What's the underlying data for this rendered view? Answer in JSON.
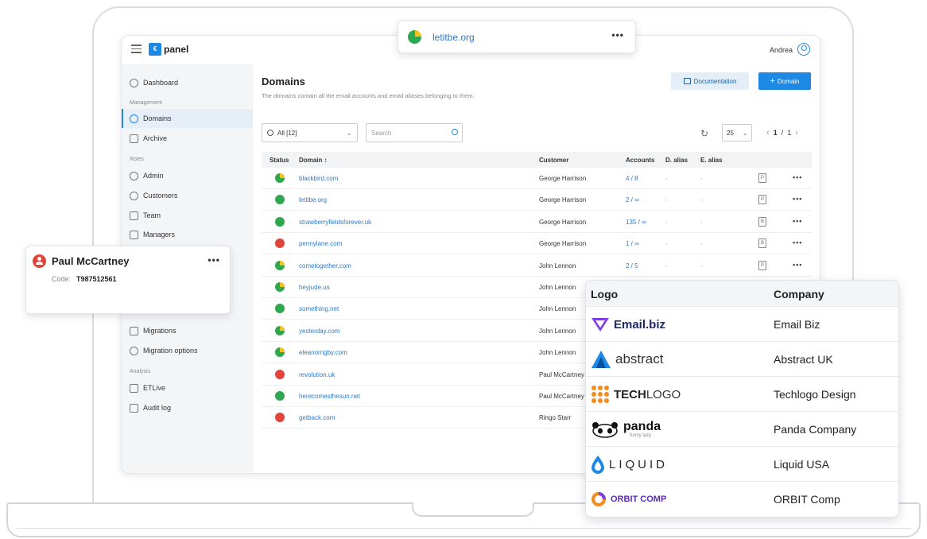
{
  "app": {
    "logo_text": "panel",
    "user_name": "Andrea"
  },
  "sidebar": {
    "dashboard": "Dashboard",
    "section_management": "Management",
    "domains": "Domains",
    "archive": "Archive",
    "section_roles": "Roles",
    "admin": "Admin",
    "customers": "Customers",
    "team": "Team",
    "managers": "Managers",
    "migrations": "Migrations",
    "migration_options": "Migration options",
    "section_analysis": "Analysis",
    "etlive": "ETLive",
    "audit_log": "Audit log"
  },
  "page": {
    "title": "Domains",
    "description": "The domains contain all the email accounts and email aliases belonging to them.",
    "documentation_label": "Documentation",
    "add_domain_label": "Domain",
    "add_domain_icon": "+"
  },
  "toolbar": {
    "filter_value": "All [12]",
    "search_placeholder": "Search",
    "per_page": "25",
    "pager_current": "1",
    "pager_total": "1"
  },
  "table": {
    "headers": [
      "Status",
      "Domain ↕",
      "Customer",
      "Accounts",
      "D. alias",
      "E. alias"
    ],
    "rows": [
      {
        "status": "mixed",
        "domain": "blackbird.com",
        "customer": "George Harrison",
        "accounts": "4 / 8",
        "dalias": "-",
        "ealias": "-",
        "doc": "P"
      },
      {
        "status": "green",
        "domain": "letitbe.org",
        "customer": "George Harrison",
        "accounts": "2 / ∞",
        "dalias": "-",
        "ealias": "-",
        "doc": "P"
      },
      {
        "status": "green",
        "domain": "strawberryfieldsforever.uk",
        "customer": "George Harrison",
        "accounts": "135 / ∞",
        "dalias": "-",
        "ealias": "-",
        "doc": "B"
      },
      {
        "status": "red",
        "domain": "pennylane.com",
        "customer": "George Harrison",
        "accounts": "1 / ∞",
        "dalias": "-",
        "ealias": "-",
        "doc": "B"
      },
      {
        "status": "mixed",
        "domain": "cometogether.com",
        "customer": "John Lennon",
        "accounts": "2 / 5",
        "dalias": "-",
        "ealias": "-",
        "doc": "P"
      },
      {
        "status": "mixed",
        "domain": "heyjude.us",
        "customer": "John Lennon"
      },
      {
        "status": "green",
        "domain": "something.net",
        "customer": "John Lennon"
      },
      {
        "status": "mixed",
        "domain": "yesterday.com",
        "customer": "John Lennon"
      },
      {
        "status": "mixed",
        "domain": "eleanorrigby.com",
        "customer": "John Lennon"
      },
      {
        "status": "red",
        "domain": "revolution.uk",
        "customer": "Paul McCartney"
      },
      {
        "status": "green",
        "domain": "herecomesthesun.net",
        "customer": "Paul McCartney"
      },
      {
        "status": "red",
        "domain": "getback.com",
        "customer": "Ringo Starr"
      }
    ]
  },
  "domain_card": {
    "name": "letitbe.org"
  },
  "user_card": {
    "name": "Paul McCartney",
    "code_label": "Code:",
    "code_value": "T987512561"
  },
  "logo_table": {
    "header_logo": "Logo",
    "header_company": "Company",
    "rows": [
      {
        "logo_text": "Email.biz",
        "company": "Email Biz"
      },
      {
        "logo_text": "abstract",
        "company": "Abstract UK"
      },
      {
        "logo_text_bold": "TECH",
        "logo_text_light": "LOGO",
        "company": "Techlogo Design"
      },
      {
        "logo_text": "panda",
        "logo_sub": "funny lazy",
        "company": "Panda Company"
      },
      {
        "logo_text": "LIQUID",
        "company": "Liquid USA"
      },
      {
        "logo_text": "ORBIT COMP",
        "company": "ORBIT Comp"
      }
    ]
  },
  "colors": {
    "accent": "#1e88e5",
    "link": "#2d7ac9",
    "status_green": "#2ea84f",
    "status_red": "#e0443a",
    "status_yellow": "#f4c21e"
  }
}
